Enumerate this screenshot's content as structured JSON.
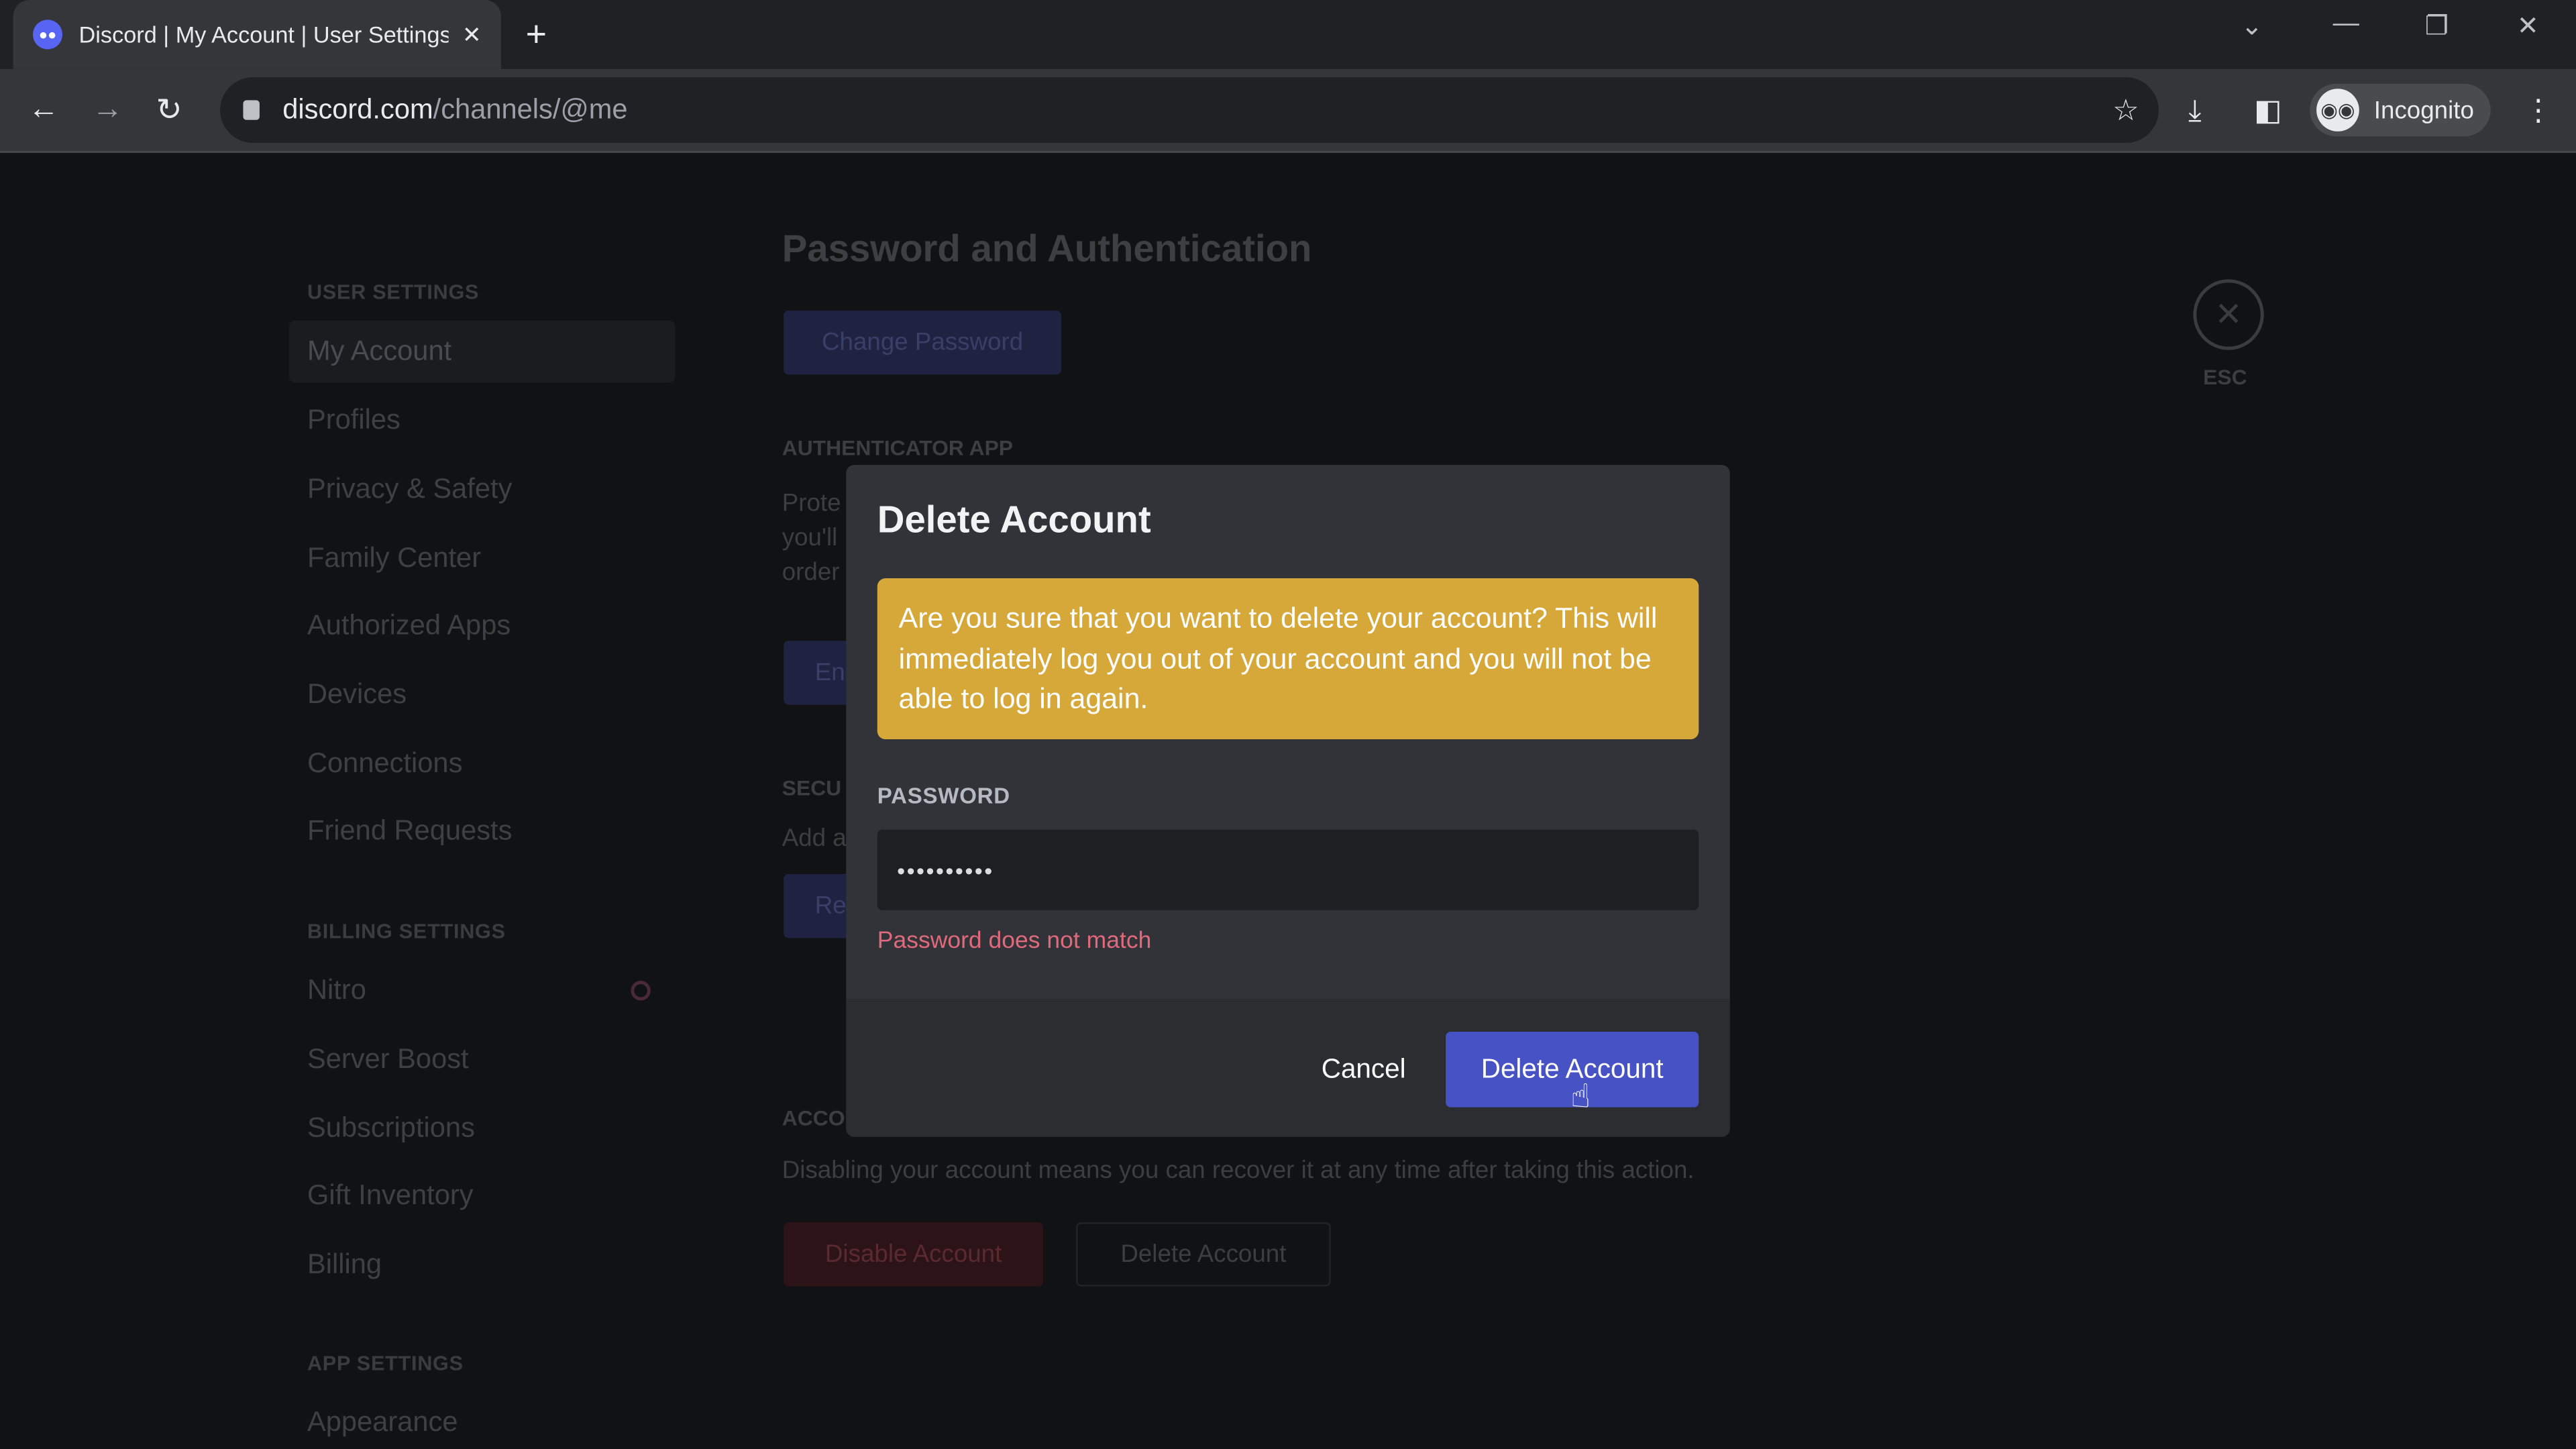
{
  "browser": {
    "tab_title": "Discord | My Account | User Settings",
    "url_host": "discord.com",
    "url_path": "/channels/@me",
    "profile": "Incognito"
  },
  "sidebar": {
    "user_heading": "USER SETTINGS",
    "user_items": [
      "My Account",
      "Profiles",
      "Privacy & Safety",
      "Family Center",
      "Authorized Apps",
      "Devices",
      "Connections",
      "Friend Requests"
    ],
    "billing_heading": "BILLING SETTINGS",
    "billing_items": [
      "Nitro",
      "Server Boost",
      "Subscriptions",
      "Gift Inventory",
      "Billing"
    ],
    "app_heading": "APP SETTINGS",
    "app_items": [
      "Appearance"
    ]
  },
  "content": {
    "title": "Password and Authentication",
    "change_password": "Change Password",
    "auth_heading": "AUTHENTICATOR APP",
    "auth_lines": [
      "Prote",
      "you'll",
      "order"
    ],
    "enable_btn": "En",
    "security_heading": "SECU",
    "security_text": "Add a",
    "security_btn": "Re",
    "account_heading": "ACCO",
    "account_text": "Disabling your account means you can recover it at any time after taking this action.",
    "disable_btn": "Disable Account",
    "delete_btn": "Delete Account",
    "esc_label": "ESC"
  },
  "modal": {
    "title": "Delete Account",
    "warning": "Are you sure that you want to delete your account? This will immediately log you out of your account and you will not be able to log in again.",
    "password_label": "PASSWORD",
    "password_value": "••••••••••",
    "error": "Password does not match",
    "cancel": "Cancel",
    "confirm": "Delete Account"
  },
  "colors": {
    "warning": "#d6a83a",
    "primary": "#4752c4",
    "error": "#e06a7c"
  }
}
